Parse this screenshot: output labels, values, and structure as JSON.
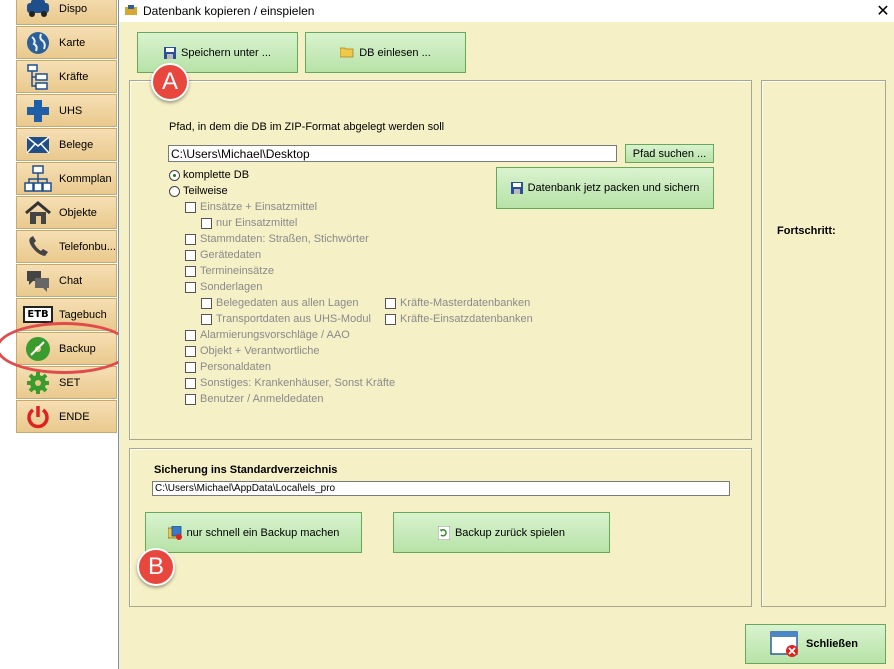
{
  "sidebar": {
    "items": [
      {
        "label": "Dispo",
        "icon": "car-icon"
      },
      {
        "label": "Karte",
        "icon": "globe-icon"
      },
      {
        "label": "Kräfte",
        "icon": "hierarchy-icon"
      },
      {
        "label": "UHS",
        "icon": "cross-icon"
      },
      {
        "label": "Belege",
        "icon": "envelope-icon"
      },
      {
        "label": "Kommplan",
        "icon": "network-icon"
      },
      {
        "label": "Objekte",
        "icon": "house-icon"
      },
      {
        "label": "Telefonbu...",
        "icon": "phone-icon"
      },
      {
        "label": "Chat",
        "icon": "chat-icon"
      },
      {
        "label": "Tagebuch",
        "icon": "etb-icon",
        "icon_text": "ETB"
      },
      {
        "label": "Backup",
        "icon": "backup-disc-icon"
      },
      {
        "label": "SET",
        "icon": "gear-icon"
      },
      {
        "label": "ENDE",
        "icon": "power-icon"
      }
    ]
  },
  "window": {
    "title": "Datenbank kopieren / einspielen",
    "close_glyph": "✕"
  },
  "toolbar": {
    "save_as_label": "Speichern unter ...",
    "load_db_label": "DB einlesen ..."
  },
  "export": {
    "path_caption": "Pfad, in dem die DB im ZIP-Format abgelegt werden soll",
    "path_value": "C:\\Users\\Michael\\Desktop",
    "search_path_label": "Pfad suchen ...",
    "pack_button_label": "Datenbank jetz packen und sichern",
    "radio_full": "komplette DB",
    "radio_partial": "Teilweise",
    "selected_mode": "komplette DB",
    "options": {
      "einsaetze": "Einsätze + Einsatzmittel",
      "nur_einsatzmittel": "nur Einsatzmittel",
      "stammdaten": "Stammdaten: Straßen, Stichwörter",
      "geraetedaten": "Gerätedaten",
      "termineinsaetze": "Termineinsätze",
      "sonderlagen": "Sonderlagen",
      "belegedaten": "Belegedaten aus allen Lagen",
      "transportdaten": "Transportdaten aus UHS-Modul",
      "kraefte_master": "Kräfte-Masterdatenbanken",
      "kraefte_einsatz": "Kräfte-Einsatzdatenbanken",
      "alarmierung": "Alarmierungsvorschläge / AAO",
      "objekt": "Objekt + Verantwortliche",
      "personaldaten": "Personaldaten",
      "sonstiges": "Sonstiges: Krankenhäuser, Sonst Kräfte",
      "benutzer": "Benutzer / Anmeldedaten"
    }
  },
  "progress": {
    "label": "Fortschritt:"
  },
  "standard_backup": {
    "heading": "Sicherung ins Standardverzeichnis",
    "path_value": "C:\\Users\\Michael\\AppData\\Local\\els_pro",
    "quick_backup_label": "nur schnell ein Backup machen",
    "restore_label": "Backup zurück spielen"
  },
  "footer": {
    "close_label": "Schließen"
  },
  "annotations": {
    "badge_a": "A",
    "badge_b": "B"
  },
  "colors": {
    "window_bg": "#f5f0c6",
    "button_green": "#b7e2a7",
    "sidebar_orange": "#e9c98d",
    "badge_red": "#e8473e",
    "highlight_ring": "#e24b4b"
  }
}
